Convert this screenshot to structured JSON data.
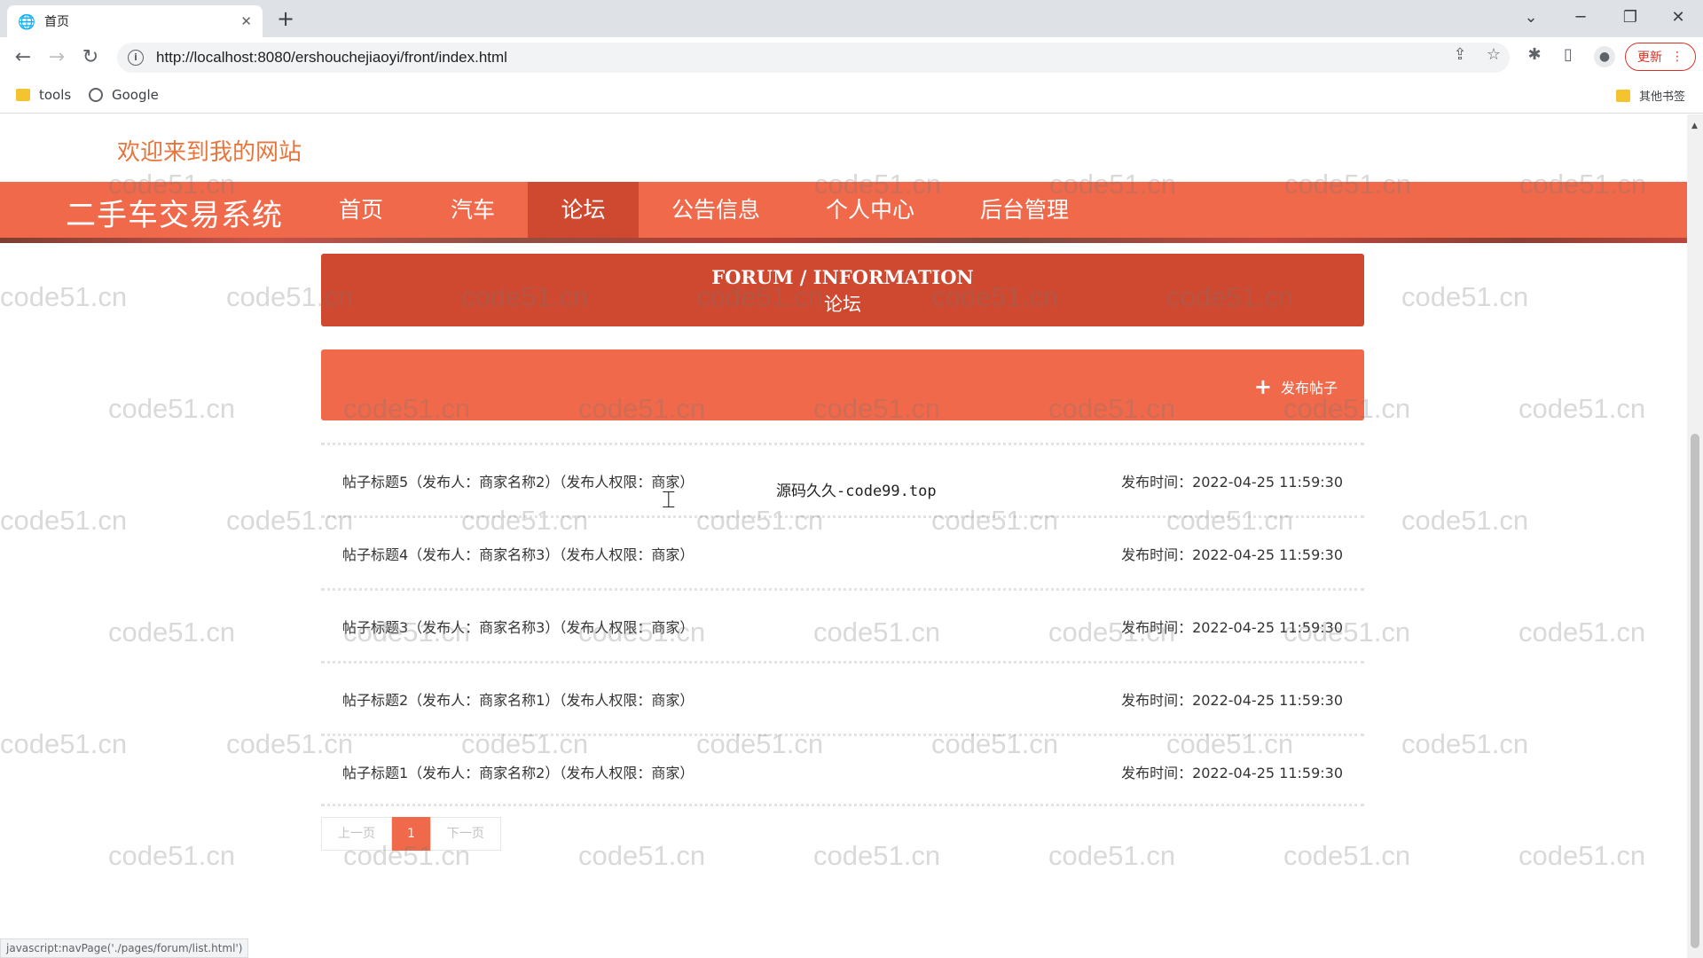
{
  "browser": {
    "tab_title": "首页",
    "url": "http://localhost:8080/ershouchejiaoyi/front/index.html",
    "update_label": "更新",
    "bookmarks": [
      {
        "label": "tools",
        "icon": "folder-icon"
      },
      {
        "label": "Google",
        "icon": "globe-icon"
      }
    ],
    "other_bookmarks": "其他书签",
    "status_text": "javascript:navPage('./pages/forum/list.html')"
  },
  "header": {
    "welcome": "欢迎来到我的网站",
    "brand": "二手车交易系统",
    "nav": [
      {
        "label": "首页",
        "active": false
      },
      {
        "label": "汽车",
        "active": false
      },
      {
        "label": "论坛",
        "active": true
      },
      {
        "label": "公告信息",
        "active": false
      },
      {
        "label": "个人中心",
        "active": false
      },
      {
        "label": "后台管理",
        "active": false
      }
    ]
  },
  "forum": {
    "title_en": "FORUM / INFORMATION",
    "title_cn": "论坛",
    "publish_label": "发布帖子",
    "posts": [
      {
        "title": "帖子标题5（发布人：商家名称2）（发布人权限：商家）",
        "time": "发布时间：2022-04-25 11:59:30"
      },
      {
        "title": "帖子标题4（发布人：商家名称3）（发布人权限：商家）",
        "time": "发布时间：2022-04-25 11:59:30"
      },
      {
        "title": "帖子标题3（发布人：商家名称3）（发布人权限：商家）",
        "time": "发布时间：2022-04-25 11:59:30"
      },
      {
        "title": "帖子标题2（发布人：商家名称1）（发布人权限：商家）",
        "time": "发布时间：2022-04-25 11:59:30"
      },
      {
        "title": "帖子标题1（发布人：商家名称2）（发布人权限：商家）",
        "time": "发布时间：2022-04-25 11:59:30"
      }
    ],
    "side_note": "源码久久-code99.top"
  },
  "pager": {
    "prev": "上一页",
    "current": "1",
    "next": "下一页"
  },
  "watermark": "code51.cn",
  "colors": {
    "nav_bg": "#f0694a",
    "nav_active": "#cf4930",
    "banner_bg": "#cf4930",
    "welcome_text": "#e4763e"
  }
}
